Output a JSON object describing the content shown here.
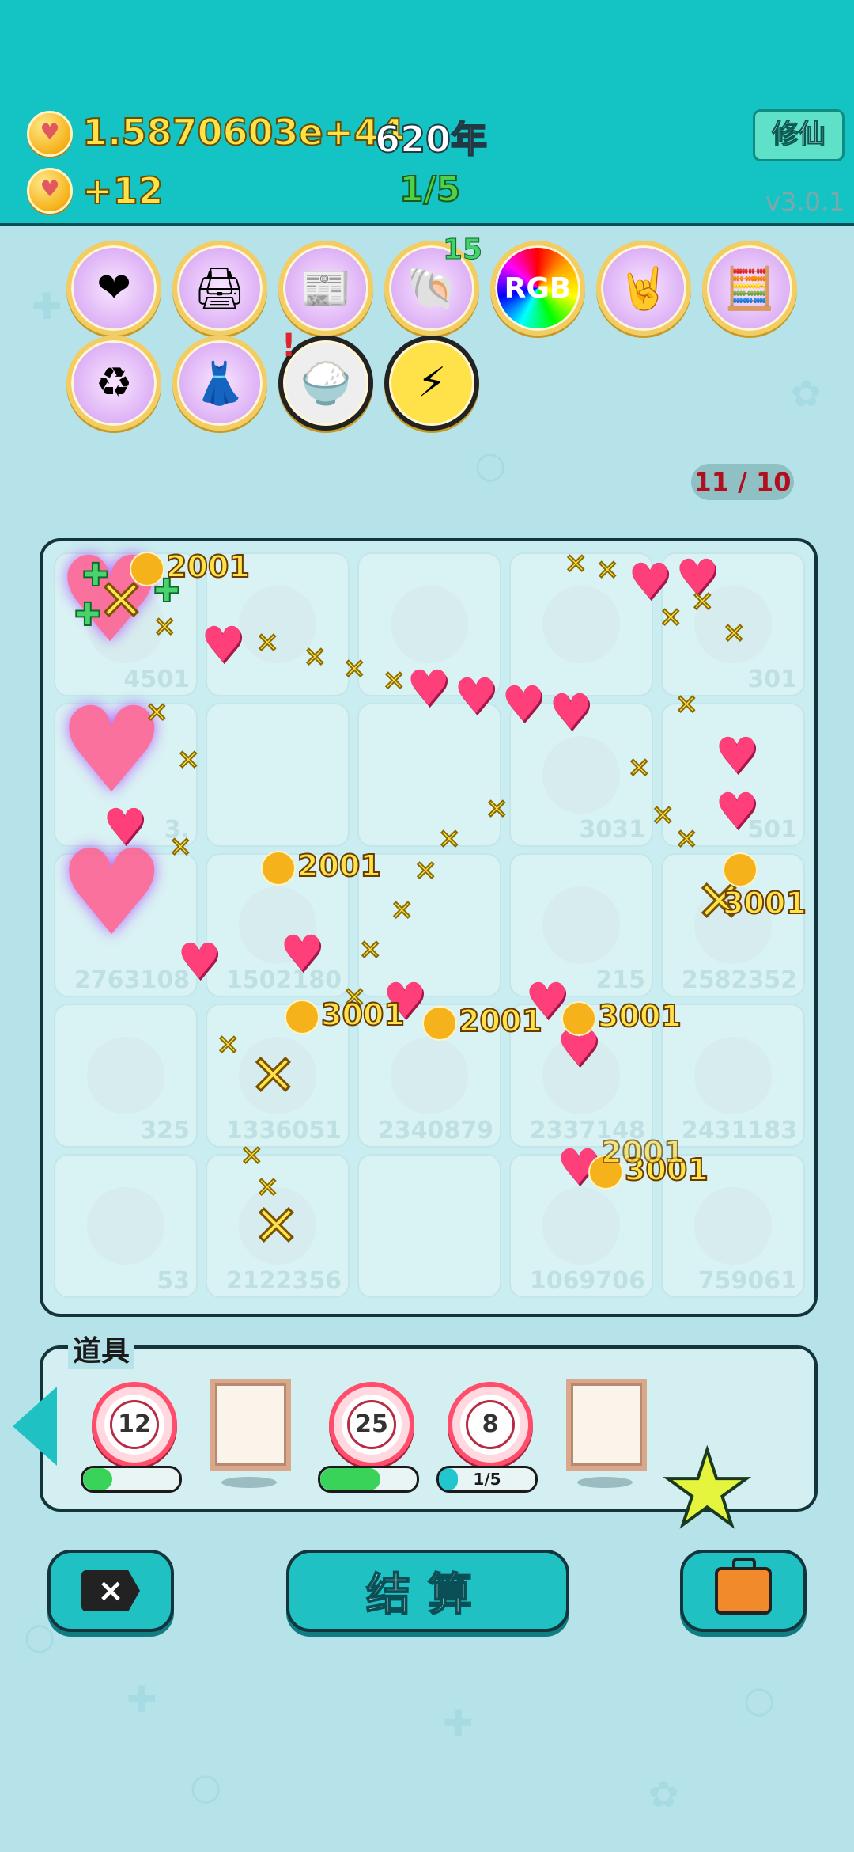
{
  "hud": {
    "money": "1.5870603e+44",
    "year": "620年",
    "income": "+12",
    "stage": "1/5",
    "mode_button": "修仙",
    "version": "v3.0.1"
  },
  "skills": {
    "row1": [
      "heart-potion-icon",
      "printer-icon",
      "time-magazine-icon",
      "shell-icon",
      "rgb-icon",
      "rock-hand-icon",
      "math-head-icon"
    ],
    "row2": [
      "recycle-icon",
      "skirt-icon",
      "rice-bowl-icon",
      "lightning-icon"
    ],
    "shell_count": "15",
    "alert_mark": "!"
  },
  "board": {
    "slots": "11 / 10",
    "cell_numbers": [
      "4501",
      "",
      "",
      "301",
      "3.",
      "",
      "3031",
      "501",
      "2763108",
      "1502180",
      "215",
      "2582352",
      "325",
      "1336051",
      "2340879",
      "2337148",
      "2431183",
      "53",
      "2122356",
      "",
      "1069706",
      "759061"
    ],
    "coin_labels": [
      "2001",
      "2001",
      "3001",
      "3001",
      "2001",
      "3001",
      "3001",
      "2001"
    ]
  },
  "props": {
    "title": "道具",
    "items": [
      {
        "name": "target",
        "level": "12",
        "progress": 0.3,
        "bar_color": "#3ad35a",
        "bar_label": ""
      },
      {
        "name": "frame",
        "level": "",
        "progress": 0,
        "bar_color": "",
        "bar_label": ""
      },
      {
        "name": "target",
        "level": "25",
        "progress": 0.62,
        "bar_color": "#3ad35a",
        "bar_label": ""
      },
      {
        "name": "target",
        "level": "8",
        "progress": 0.2,
        "bar_color": "#21c6cf",
        "bar_label": "1/5"
      },
      {
        "name": "frame",
        "level": "",
        "progress": 0,
        "bar_color": "",
        "bar_label": ""
      }
    ]
  },
  "buttons": {
    "close": "×",
    "settle": "结算"
  }
}
